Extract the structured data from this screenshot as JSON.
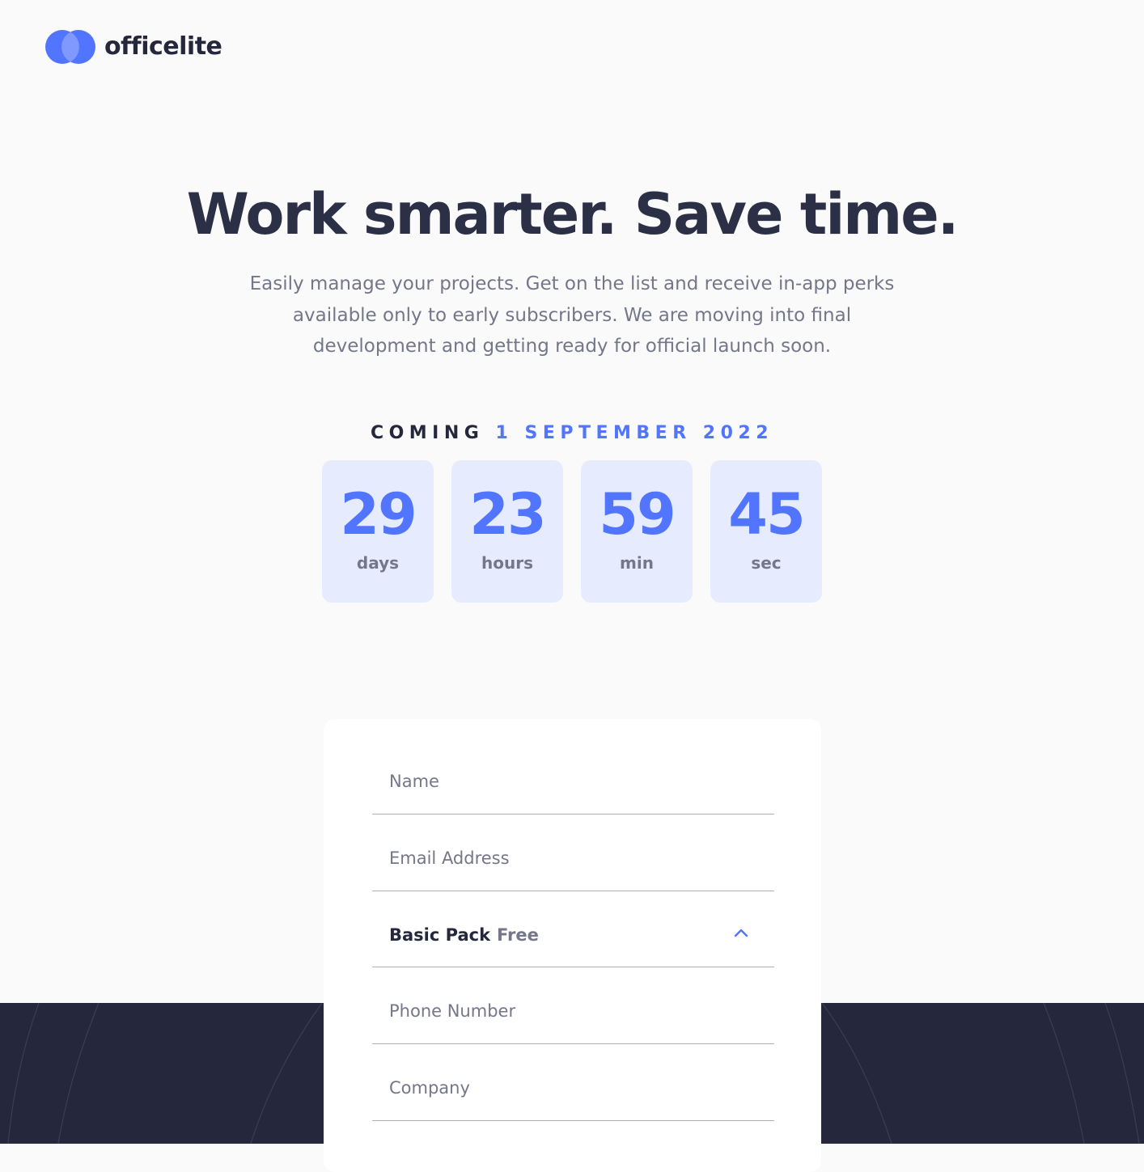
{
  "brand": {
    "name": "officelite",
    "logo_color_primary": "#5175ff",
    "logo_color_secondary": "#7f99ff"
  },
  "hero": {
    "title": "Work smarter. Save time.",
    "description": "Easily manage your projects. Get on the list and receive in-app perks available only to early subscribers. We are moving into final development and getting ready for official launch soon."
  },
  "coming": {
    "prefix": "COMING",
    "date": "1 SEPTEMBER 2022"
  },
  "countdown": {
    "days": {
      "value": "29",
      "unit": "days"
    },
    "hours": {
      "value": "23",
      "unit": "hours"
    },
    "minutes": {
      "value": "59",
      "unit": "min"
    },
    "seconds": {
      "value": "45",
      "unit": "sec"
    }
  },
  "form": {
    "name_placeholder": "Name",
    "email_placeholder": "Email Address",
    "plan": {
      "selected_name": "Basic Pack",
      "selected_price": "Free",
      "icon": "chevron-up-icon"
    },
    "phone_placeholder": "Phone Number",
    "company_placeholder": "Company"
  },
  "colors": {
    "accent": "#5175ff",
    "dark": "#25283c",
    "muted": "#74778a",
    "countdown_bg": "#e6ebfd",
    "page_bg": "#fafafa"
  }
}
